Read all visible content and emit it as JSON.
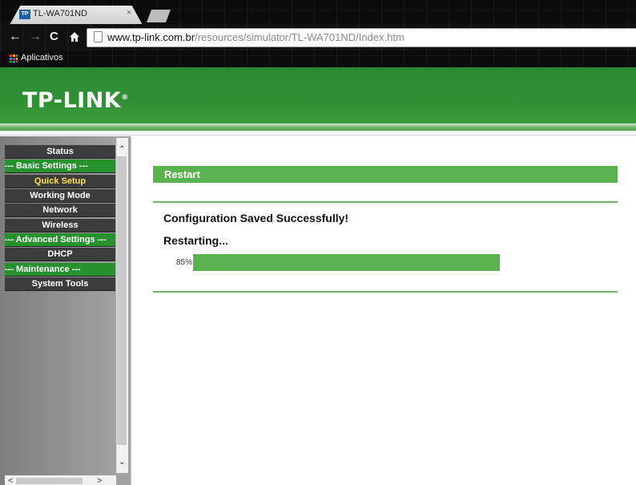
{
  "browser": {
    "tab_title": "TL-WA701ND",
    "tab_favicon_text": "TP",
    "tab_close": "×",
    "url_host": "www.tp-link.com.br",
    "url_path": "/resources/simulator/TL-WA701ND/Index.htm",
    "bookmarks_apps": "Aplicativos"
  },
  "brand": {
    "logo": "TP-LINK",
    "logo_mark": "®",
    "brand_green": "#2f8f34"
  },
  "sidebar": {
    "items": [
      {
        "label": "Status",
        "kind": "item"
      },
      {
        "label": "--- Basic Settings ---",
        "kind": "section"
      },
      {
        "label": "Quick Setup",
        "kind": "item",
        "active": true
      },
      {
        "label": "Working Mode",
        "kind": "item"
      },
      {
        "label": "Network",
        "kind": "item"
      },
      {
        "label": "Wireless",
        "kind": "item"
      },
      {
        "label": "--- Advanced Settings ---",
        "kind": "section"
      },
      {
        "label": "DHCP",
        "kind": "item"
      },
      {
        "label": "--- Maintenance ---",
        "kind": "section"
      },
      {
        "label": "System Tools",
        "kind": "item"
      }
    ]
  },
  "main": {
    "title": "Restart",
    "saved_message": "Configuration Saved Successfully!",
    "restarting_message": "Restarting...",
    "progress_label": "85%",
    "progress_value": 0.85,
    "accent_color": "#5ab24f"
  },
  "icons": [
    "back-arrow-icon",
    "forward-arrow-icon",
    "reload-icon",
    "home-icon",
    "page-icon",
    "apps-grid-icon"
  ]
}
